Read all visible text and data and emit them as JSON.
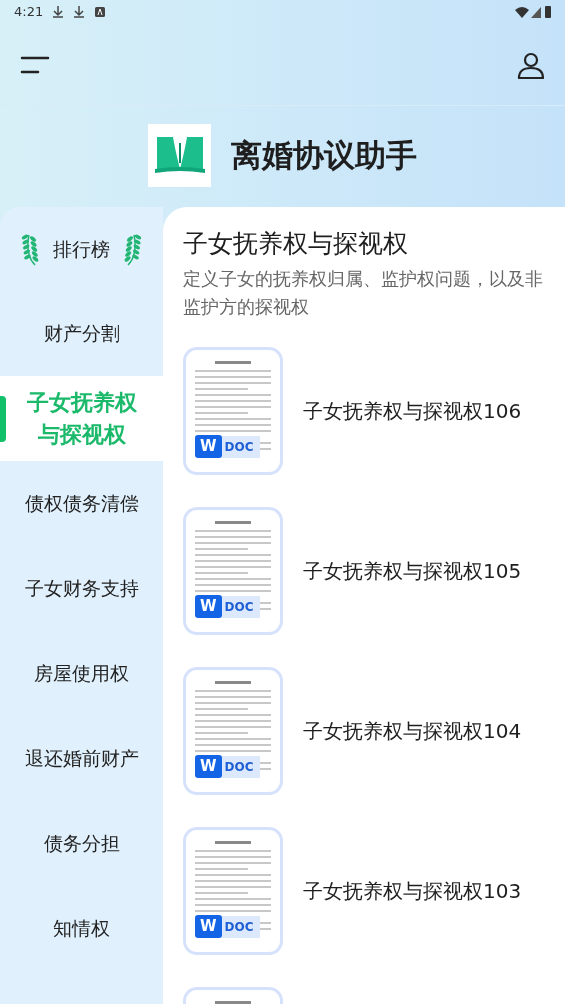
{
  "status_bar": {
    "time": "4:21"
  },
  "app": {
    "title": "离婚协议助手"
  },
  "sidebar": {
    "ranking": {
      "label": "排行榜"
    },
    "items": [
      {
        "label": "财产分割",
        "selected": false
      },
      {
        "label": "子女抚养权与探视权",
        "selected": true
      },
      {
        "label": "债权债务清偿",
        "selected": false
      },
      {
        "label": "子女财务支持",
        "selected": false
      },
      {
        "label": "房屋使用权",
        "selected": false
      },
      {
        "label": "退还婚前财产",
        "selected": false
      },
      {
        "label": "债务分担",
        "selected": false
      },
      {
        "label": "知情权",
        "selected": false
      }
    ]
  },
  "content": {
    "title": "子女抚养权与探视权",
    "description": "定义子女的抚养权归属、监护权问题，以及非监护方的探视权",
    "documents": [
      {
        "title": "子女抚养权与探视权106",
        "badge_letter": "W",
        "badge_type": "DOC"
      },
      {
        "title": "子女抚养权与探视权105",
        "badge_letter": "W",
        "badge_type": "DOC"
      },
      {
        "title": "子女抚养权与探视权104",
        "badge_letter": "W",
        "badge_type": "DOC"
      },
      {
        "title": "子女抚养权与探视权103",
        "badge_letter": "W",
        "badge_type": "DOC"
      }
    ]
  }
}
